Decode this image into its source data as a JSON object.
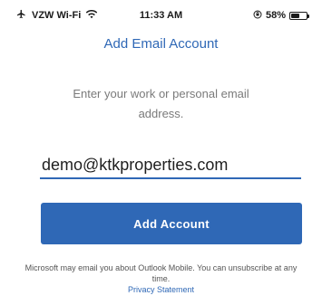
{
  "status_bar": {
    "carrier": "VZW Wi-Fi",
    "time": "11:33 AM",
    "battery_percent": "58%",
    "battery_level": 0.58,
    "icons": [
      "airplane-icon",
      "wifi-icon",
      "orientation-lock-icon",
      "battery-icon"
    ]
  },
  "nav": {
    "title": "Add Email Account"
  },
  "prompt": {
    "text": "Enter your work or personal email address."
  },
  "email_field": {
    "value": "demo@ktkproperties.com"
  },
  "add_button": {
    "label": "Add Account"
  },
  "disclaimer": {
    "text": "Microsoft may email you about Outlook Mobile. You can unsubscribe at any time.",
    "privacy_link": "Privacy Statement"
  },
  "colors": {
    "accent": "#2f68b6",
    "prompt_text": "#7a7a7a"
  }
}
